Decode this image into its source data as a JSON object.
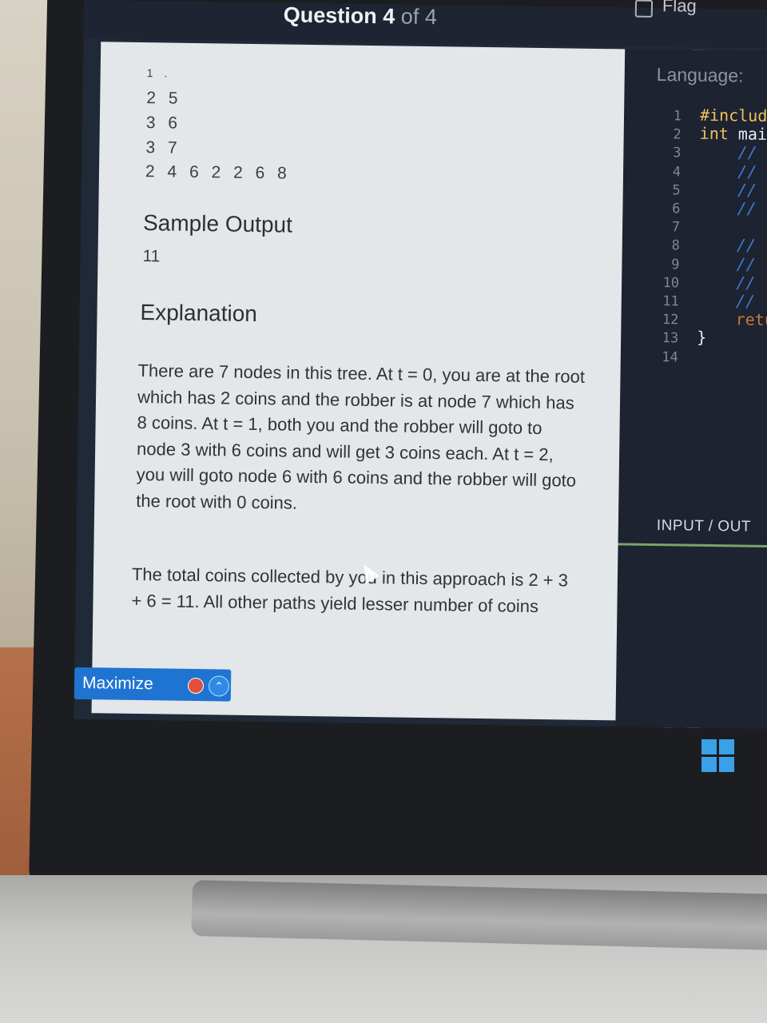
{
  "header": {
    "question_prefix": "Question 4",
    "question_suffix": "of 4",
    "flag_label": "Flag"
  },
  "problem": {
    "input_partial_line": "1 .",
    "input_lines": [
      "2 5",
      "3 6",
      "3 7",
      "2 4 6 2 2 6 8"
    ],
    "sample_output_heading": "Sample Output",
    "sample_output_value": "11",
    "explanation_heading": "Explanation",
    "explanation_paragraph_1": "There are 7 nodes in this tree. At t = 0, you are at the root which has 2 coins and the robber is at node 7 which has 8 coins. At t = 1, both you and the robber will goto to node 3 with 6 coins and will get 3 coins each. At t = 2, you will goto node 6 with 6 coins and the robber will goto the root with 0 coins.",
    "explanation_paragraph_2": "The total coins collected by you in this approach is 2 + 3 + 6 = 11. All other paths yield lesser number of coins"
  },
  "maximize_bar": {
    "label": "Maximize",
    "recording_icon": "record-dot-icon",
    "expand_icon": "chevron-up-icon"
  },
  "editor": {
    "language_label": "Language:",
    "line_numbers": [
      "1",
      "2",
      "3",
      "4",
      "5",
      "6",
      "7",
      "8",
      "9",
      "10",
      "11",
      "12",
      "13",
      "14"
    ],
    "code_line_1": "#includ",
    "code_line_2_kw": "int",
    "code_line_2_rest": " mai",
    "comment_marker": "//",
    "return_partial": "retu",
    "closing_brace": "}",
    "io_label": "INPUT / OUT"
  },
  "taskbar": {
    "start_icon": "windows-logo-icon"
  },
  "colors": {
    "accent_blue": "#1f74d2",
    "editor_bg": "#1d2330",
    "problem_bg": "#e3e7ea",
    "keyword": "#f0c15a",
    "comment": "#3a7bd5"
  }
}
